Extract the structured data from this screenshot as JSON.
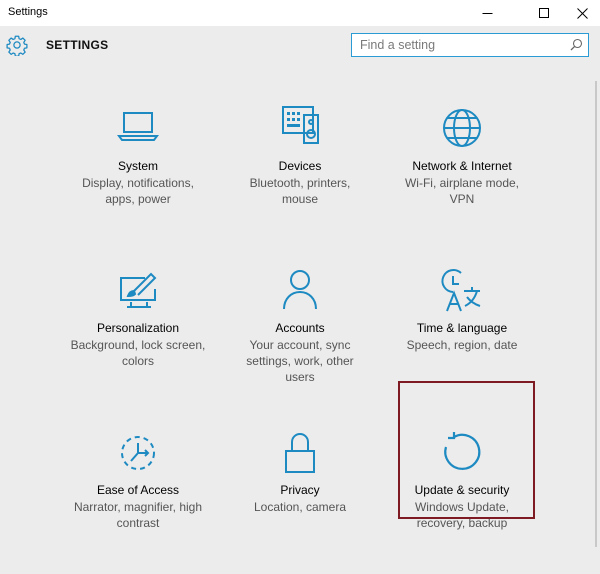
{
  "window": {
    "title": "Settings",
    "minimize_icon": "minimize-icon",
    "maximize_icon": "maximize-icon",
    "close_icon": "close-icon"
  },
  "header": {
    "title": "SETTINGS",
    "icon": "gear-icon"
  },
  "search": {
    "placeholder": "Find a setting",
    "value": "",
    "icon": "search-icon"
  },
  "colors": {
    "accent": "#1e8ac2",
    "search_border": "#2b9bd5",
    "highlight_border": "#7d1a22",
    "background": "#ececec"
  },
  "tiles": [
    {
      "name": "System",
      "description": "Display, notifications, apps, power",
      "icon": "laptop-icon"
    },
    {
      "name": "Devices",
      "description": "Bluetooth, printers, mouse",
      "icon": "devices-icon"
    },
    {
      "name": "Network & Internet",
      "description": "Wi-Fi, airplane mode, VPN",
      "icon": "globe-icon"
    },
    {
      "name": "Personalization",
      "description": "Background, lock screen, colors",
      "icon": "paint-icon"
    },
    {
      "name": "Accounts",
      "description": "Your account, sync settings, work, other users",
      "icon": "person-icon"
    },
    {
      "name": "Time & language",
      "description": "Speech, region, date",
      "icon": "time-language-icon"
    },
    {
      "name": "Ease of Access",
      "description": "Narrator, magnifier, high contrast",
      "icon": "ease-of-access-icon"
    },
    {
      "name": "Privacy",
      "description": "Location, camera",
      "icon": "lock-icon"
    },
    {
      "name": "Update & security",
      "description": "Windows Update, recovery, backup",
      "icon": "update-icon",
      "highlighted": true
    }
  ]
}
